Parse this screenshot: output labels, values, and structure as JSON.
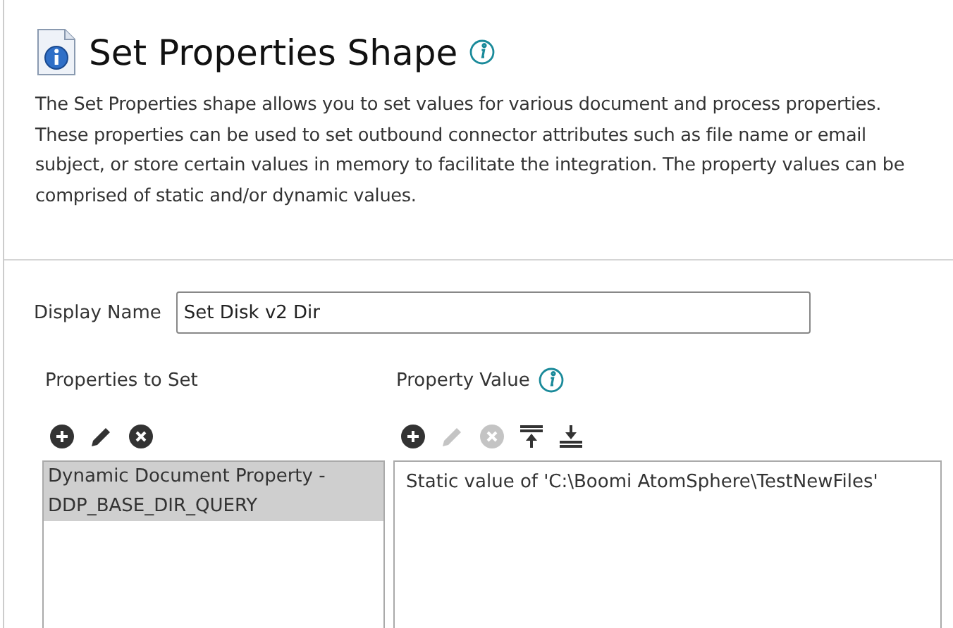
{
  "header": {
    "title": "Set Properties Shape",
    "description": "The Set Properties shape allows you to set values for various document and process properties. These properties can be used to set outbound connector attributes such as file name or email subject, or store certain values in memory to facilitate the integration. The property values can be comprised of static and/or dynamic values."
  },
  "display_name": {
    "label": "Display Name",
    "value": "Set Disk v2 Dir"
  },
  "properties_panel": {
    "label": "Properties to Set",
    "info": false,
    "toolbar": [
      {
        "kind": "add",
        "disabled": false
      },
      {
        "kind": "edit",
        "disabled": false
      },
      {
        "kind": "delete",
        "disabled": false
      }
    ],
    "items": [
      {
        "text": "Dynamic Document Property - DDP_BASE_DIR_QUERY",
        "selected": true
      }
    ]
  },
  "value_panel": {
    "label": "Property Value",
    "info": true,
    "toolbar": [
      {
        "kind": "add",
        "disabled": false
      },
      {
        "kind": "edit",
        "disabled": true
      },
      {
        "kind": "delete",
        "disabled": true
      },
      {
        "kind": "move-top",
        "disabled": false
      },
      {
        "kind": "move-bottom",
        "disabled": false
      }
    ],
    "items": [
      {
        "text": "Static value of 'C:\\Boomi AtomSphere\\TestNewFiles'",
        "selected": false
      }
    ]
  }
}
